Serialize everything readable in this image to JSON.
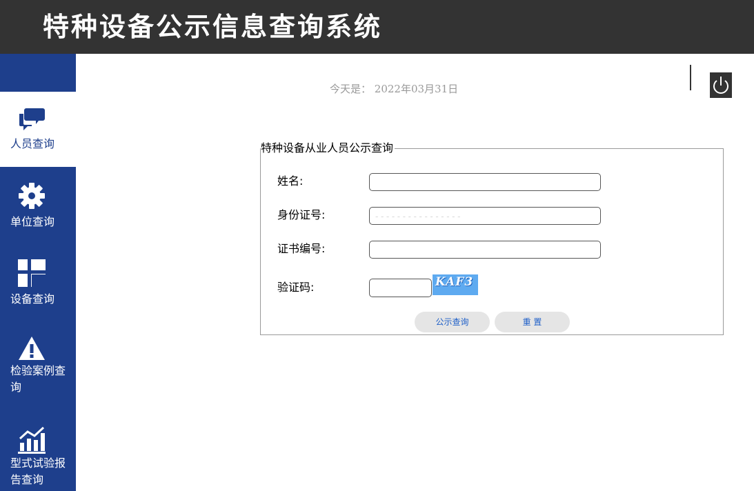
{
  "header": {
    "title": "特种设备公示信息查询系统"
  },
  "sidebar": {
    "items": [
      {
        "label": "人员查询",
        "icon": "chat-bubbles-icon",
        "active": true
      },
      {
        "label": "单位查询",
        "icon": "gear-icon",
        "active": false
      },
      {
        "label": "设备查询",
        "icon": "cross-grid-icon",
        "active": false
      },
      {
        "label": "检验案例查询",
        "icon": "warning-triangle-icon",
        "active": false
      },
      {
        "label": "型式试验报告查询",
        "icon": "bar-chart-icon",
        "active": false
      }
    ]
  },
  "date": {
    "prefix": "今天是：",
    "value": "2022年03月31日"
  },
  "form": {
    "legend": "特种设备从业人员公示查询",
    "name_label": "姓名:",
    "name_value": "",
    "id_label": "身份证号:",
    "id_value": "",
    "id_placeholder": "- - - - - - - - - - - - - - - -",
    "cert_label": "证书编号:",
    "cert_value": "",
    "captcha_label": "验证码:",
    "captcha_value": "",
    "captcha_text": "KAF3",
    "search_button": "公示查询",
    "reset_button": "重 置"
  },
  "colors": {
    "header": "#333333",
    "sidebar": "#1e3f8c",
    "accent": "#1e5fc8",
    "captcha": "#5eaaf0"
  }
}
